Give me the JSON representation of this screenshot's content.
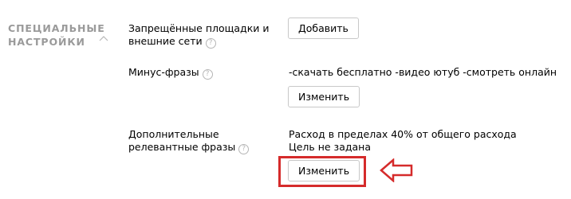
{
  "section": {
    "title_line1": "СПЕЦИАЛЬНЫЕ",
    "title_line2": "НАСТРОЙКИ",
    "collapse_icon": "chevron-up-icon"
  },
  "rows": {
    "blocked_sites": {
      "label_line1": "Запрещённые площадки и",
      "label_line2": "внешние сети",
      "help": "?",
      "button_label": "Добавить"
    },
    "negative_keywords": {
      "label": "Минус-фразы",
      "help": "?",
      "value": "-скачать бесплатно -видео ютуб -смотреть онлайн",
      "button_label": "Изменить"
    },
    "extra_phrases": {
      "label_line1": "Дополнительные",
      "label_line2": "релевантные фразы",
      "help": "?",
      "value_line1": "Расход в пределах 40% от общего расхода",
      "value_line2": "Цель не задана",
      "button_label": "Изменить"
    }
  },
  "annotation": {
    "highlight_color": "#d52b2b",
    "arrow_icon": "left-arrow-outline-icon"
  }
}
